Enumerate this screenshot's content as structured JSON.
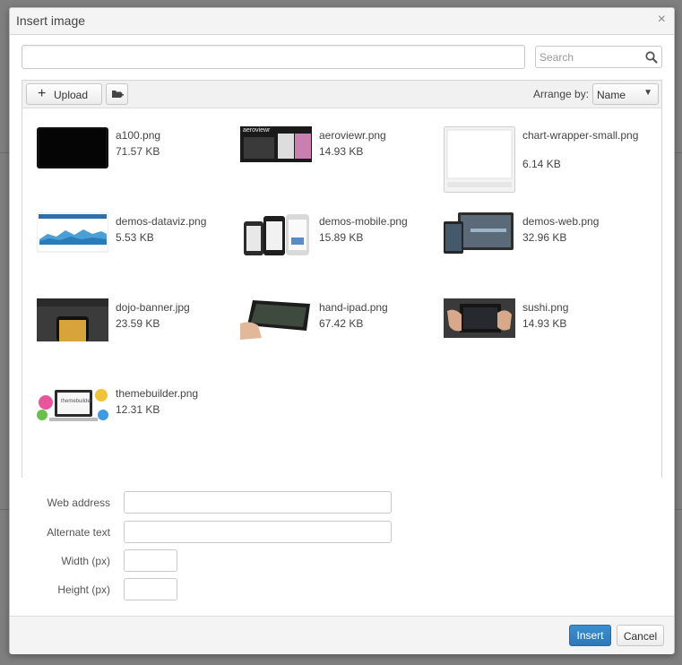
{
  "dialog": {
    "title": "Insert image",
    "close_glyph": "×"
  },
  "search": {
    "placeholder": "Search"
  },
  "toolbar": {
    "upload_label": "Upload",
    "arrange_label": "Arrange by:",
    "arrange_value": "Name"
  },
  "files": [
    {
      "name": "a100.png",
      "size": "71.57 KB"
    },
    {
      "name": "aeroviewr.png",
      "size": "14.93 KB"
    },
    {
      "name": "chart-wrapper-small.png",
      "size": "6.14 KB"
    },
    {
      "name": "demos-dataviz.png",
      "size": "5.53 KB"
    },
    {
      "name": "demos-mobile.png",
      "size": "15.89 KB"
    },
    {
      "name": "demos-web.png",
      "size": "32.96 KB"
    },
    {
      "name": "dojo-banner.jpg",
      "size": "23.59 KB"
    },
    {
      "name": "hand-ipad.png",
      "size": "67.42 KB"
    },
    {
      "name": "sushi.png",
      "size": "14.93 KB"
    },
    {
      "name": "themebuilder.png",
      "size": "12.31 KB"
    }
  ],
  "form": {
    "web_address_label": "Web address",
    "alt_text_label": "Alternate text",
    "width_label": "Width (px)",
    "height_label": "Height (px)",
    "web_address_value": "",
    "alt_text_value": "",
    "width_value": "",
    "height_value": ""
  },
  "footer": {
    "insert_label": "Insert",
    "cancel_label": "Cancel"
  },
  "thumb_text": {
    "aeroviewr_logo": "aeroviewr",
    "themebuilder_logo": "themebuilder"
  },
  "colors": {
    "accent": "#3a87c8",
    "overlay": "#7f7f7f"
  }
}
